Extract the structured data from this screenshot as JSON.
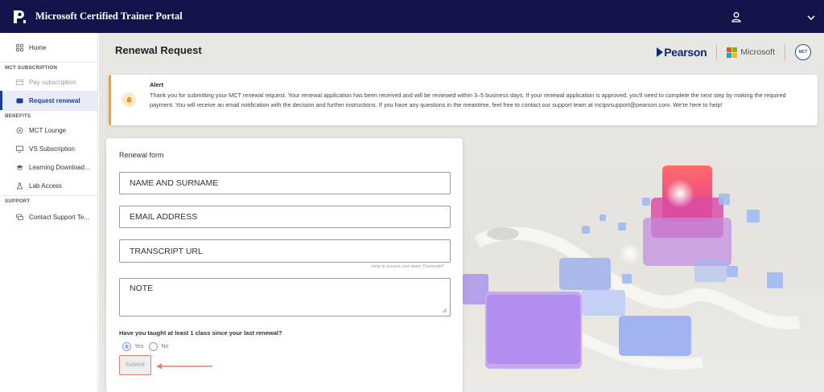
{
  "header": {
    "app_title": "Microsoft Certified Trainer Portal",
    "logo_icon": "pearson-p-logo",
    "user_icon": "user-icon",
    "menu_icon": "chevron-down-icon",
    "background": "#13134a"
  },
  "sidebar": {
    "home": "Home",
    "section_mct": "MCT SUBSCRIPTION",
    "pay": "Pay subscription",
    "renewal": "Request renewal",
    "section_benefits": "BENEFITS",
    "lounge": "MCT Lounge",
    "vs": "VS Subscription",
    "learning": "Learning Download...",
    "lab": "Lab Access",
    "section_support": "SUPPORT",
    "contact": "Contact Support Te..."
  },
  "page": {
    "title": "Renewal Request",
    "partners": {
      "pearson": "Pearson",
      "microsoft": "Microsoft",
      "mct_badge": "MCT"
    }
  },
  "alert": {
    "title": "Alert",
    "text": "Thank you for submitting your MCT renewal request. Your renewal application has been received and will be reviewed within 3–5 business days. If your renewal application is approved, you'll need to complete the next step by making the required payment. You will receive an email notification with the decision and further instructions. If you have any questions in the meantime, feel free to contact our support team at mctpvsupport@pearson.com. We're here to help!",
    "accent_color": "#f0a33a"
  },
  "form": {
    "title": "Renewal form",
    "name": "NAME AND SURNAME",
    "email": "EMAIL ADDRESS",
    "transcript": "TRANSCRIPT URL",
    "transcript_help": "How to access your learn Transcript?",
    "note": "NOTE",
    "question": "Have you taught at least 1 class since your last renewal?",
    "yes": "Yes",
    "no": "No",
    "selected": "Yes",
    "submit": "Submit"
  },
  "colors": {
    "accent": "#1a3d9c",
    "highlight": "#d9816e"
  }
}
